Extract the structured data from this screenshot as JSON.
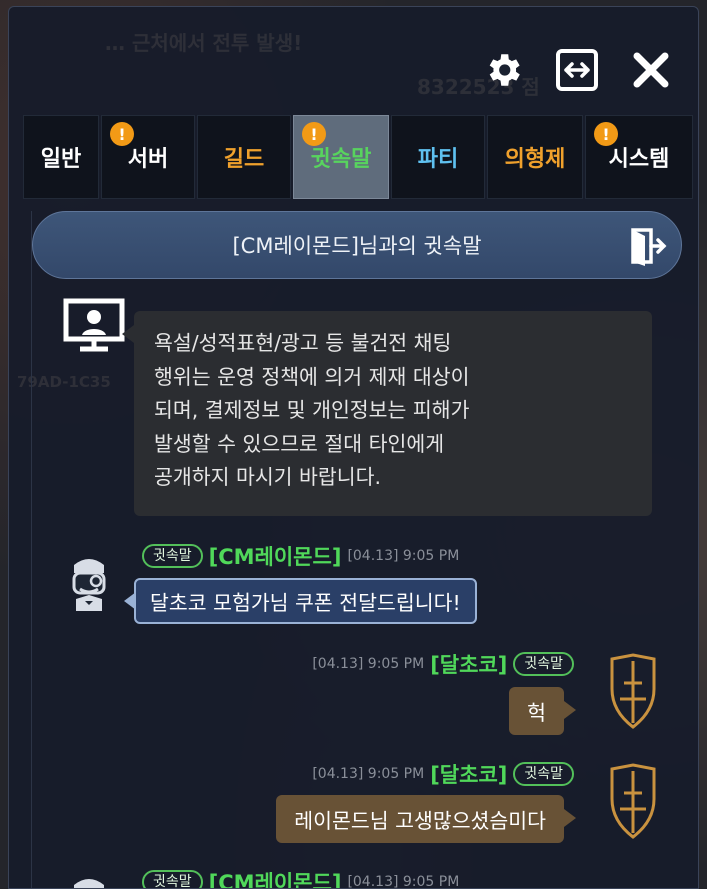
{
  "tabs": [
    {
      "label": "일반",
      "color": "#ffffff",
      "width": 76,
      "badge": false,
      "active": false
    },
    {
      "label": "서버",
      "color": "#ffffff",
      "width": 94,
      "badge": true,
      "active": false
    },
    {
      "label": "길드",
      "color": "#f0a12c",
      "width": 94,
      "badge": false,
      "active": false
    },
    {
      "label": "귓속말",
      "color": "#58d35e",
      "width": 96,
      "badge": true,
      "active": true
    },
    {
      "label": "파티",
      "color": "#5fc1f0",
      "width": 94,
      "badge": false,
      "active": false
    },
    {
      "label": "의형제",
      "color": "#f0a12c",
      "width": 96,
      "badge": false,
      "active": false
    },
    {
      "label": "시스템",
      "color": "#ffffff",
      "width": 108,
      "badge": true,
      "active": false
    }
  ],
  "badge_text": "!",
  "chat": {
    "title": "[CM레이몬드]님과의 귓속말",
    "system_notice": "욕설/성적표현/광고 등 불건전 채팅\n행위는 운영 정책에 의거 제재 대상이\n되며, 결제정보 및 개인정보는 피해가\n발생할 수 있으므로 절대 타인에게\n공개하지 마시기 바랍니다.",
    "messages": [
      {
        "tag": "귓속말",
        "sender": "[CM레이몬드]",
        "time": "[04.13] 9:05 PM",
        "text": "달초코 모험가님 쿠폰 전달드립니다!"
      },
      {
        "tag": "귓속말",
        "sender": "[달초코]",
        "time": "[04.13] 9:05 PM",
        "text": "헉"
      },
      {
        "tag": "귓속말",
        "sender": "[달초코]",
        "time": "[04.13] 9:05 PM",
        "text": "레이몬드님 고생많으셨슴미다"
      },
      {
        "tag": "귓속말",
        "sender": "[CM레이몬드]",
        "time": "[04.13] 9:05 PM",
        "text": ""
      }
    ]
  },
  "background_ghost": {
    "line1": "… 근처에서 전투 발생!",
    "score": "8322523 점",
    "code": "79AD-1C35"
  }
}
